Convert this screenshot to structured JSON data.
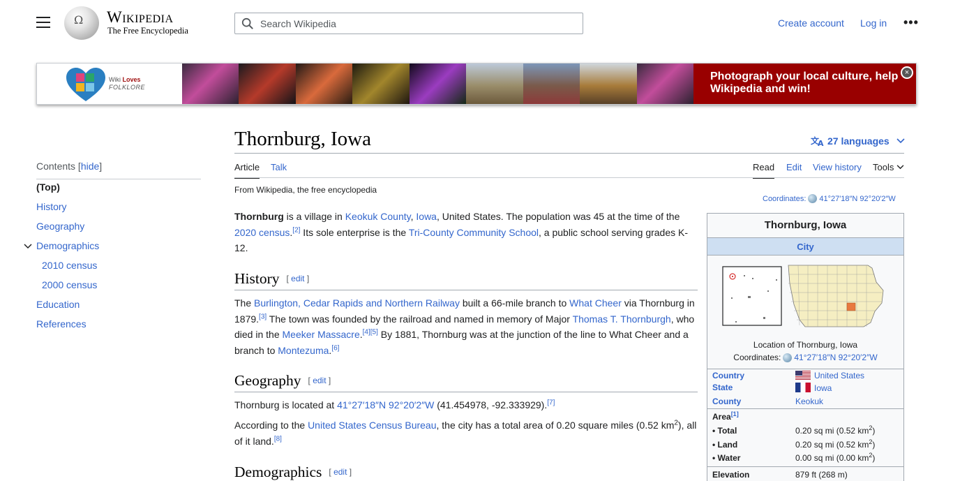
{
  "header": {
    "wordmark": "Wikipedia",
    "tagline": "The Free Encyclopedia",
    "search_placeholder": "Search Wikipedia",
    "create_account": "Create account",
    "log_in": "Log in",
    "more_menu": "•••"
  },
  "banner": {
    "logo_line1_plain": "Wiki ",
    "logo_line1_bold": "Loves",
    "logo_line2": "FOLKLORE",
    "cta": "Photograph your local culture, help Wikipedia and win!",
    "close": "×"
  },
  "toc": {
    "heading": "Contents",
    "hide_label": "hide",
    "items": [
      "(Top)",
      "History",
      "Geography",
      "Demographics",
      "2010 census",
      "2000 census",
      "Education",
      "References"
    ]
  },
  "article": {
    "title": "Thornburg, Iowa",
    "languages": "27 languages",
    "tabs": {
      "article": "Article",
      "talk": "Talk",
      "read": "Read",
      "edit": "Edit",
      "view_history": "View history",
      "tools": "Tools"
    },
    "from": "From Wikipedia, the free encyclopedia",
    "coordinates_label": "Coordinates:",
    "coordinates_value": "41°27′18″N 92°20′2″W",
    "edit_label": "edit",
    "intro": {
      "t1": "Thornburg",
      "t2": " is a village in ",
      "l1": "Keokuk County",
      "t3": ", ",
      "l2": "Iowa",
      "t4": ", United States. The population was 45 at the time of the ",
      "l3": "2020 census",
      "r1": "[2]",
      "t5": " Its sole enterprise is the ",
      "l4": "Tri-County Community School",
      "t6": ", a public school serving grades K-12."
    },
    "history": {
      "heading": "History",
      "t1": "The ",
      "l1": "Burlington, Cedar Rapids and Northern Railway",
      "t2": " built a 66-mile branch to ",
      "l2": "What Cheer",
      "t3": " via Thornburg in 1879.",
      "r1": "[3]",
      "t4": " The town was founded by the railroad and named in memory of Major ",
      "l3": "Thomas T. Thornburgh",
      "t5": ", who died in the ",
      "l4": "Meeker Massacre",
      "t6": ".",
      "r2": "[4][5]",
      "t7": " By 1881, Thornburg was at the junction of the line to What Cheer and a branch to ",
      "l5": "Montezuma",
      "t8": ".",
      "r3": "[6]"
    },
    "geography": {
      "heading": "Geography",
      "p1_t1": "Thornburg is located at ",
      "p1_l1": "41°27′18″N 92°20′2″W",
      "p1_t2": " (41.454978, -92.333929).",
      "p1_r1": "[7]",
      "p2_t1": "According to the ",
      "p2_l1": "United States Census Bureau",
      "p2_t2": ", the city has a total area of 0.20 square miles (0.52 km",
      "p2_sup": "2",
      "p2_t3": "), all of it land.",
      "p2_r1": "[8]"
    },
    "demographics": {
      "heading": "Demographics"
    }
  },
  "infobox": {
    "title": "Thornburg, Iowa",
    "subtitle": "City",
    "caption_line1": "Location of Thornburg, Iowa",
    "coordinates_label": "Coordinates:",
    "coordinates_value": "41°27′18″N 92°20′2″W",
    "country_label": "Country",
    "country_value": "United States",
    "state_label": "State",
    "state_value": "Iowa",
    "county_label": "County",
    "county_value": "Keokuk",
    "area_label": "Area",
    "area_ref": "[1]",
    "total_label": "• Total",
    "total_value": "0.20 sq mi (0.52 km",
    "total_unit_end": ")",
    "land_label": "• Land",
    "land_value": "0.20 sq mi (0.52 km",
    "land_unit_end": ")",
    "water_label": "• Water",
    "water_value": "0.00 sq mi (0.00 km",
    "water_unit_end": ")",
    "sup2": "2",
    "elevation_label": "Elevation",
    "elevation_value": "879 ft (268 m)"
  },
  "colors": {
    "link": "#3366cc",
    "banner_red": "#990000",
    "infobox_sub": "#cedff2",
    "map_highlight": "#e8793f",
    "map_fill": "#f5eec2"
  }
}
